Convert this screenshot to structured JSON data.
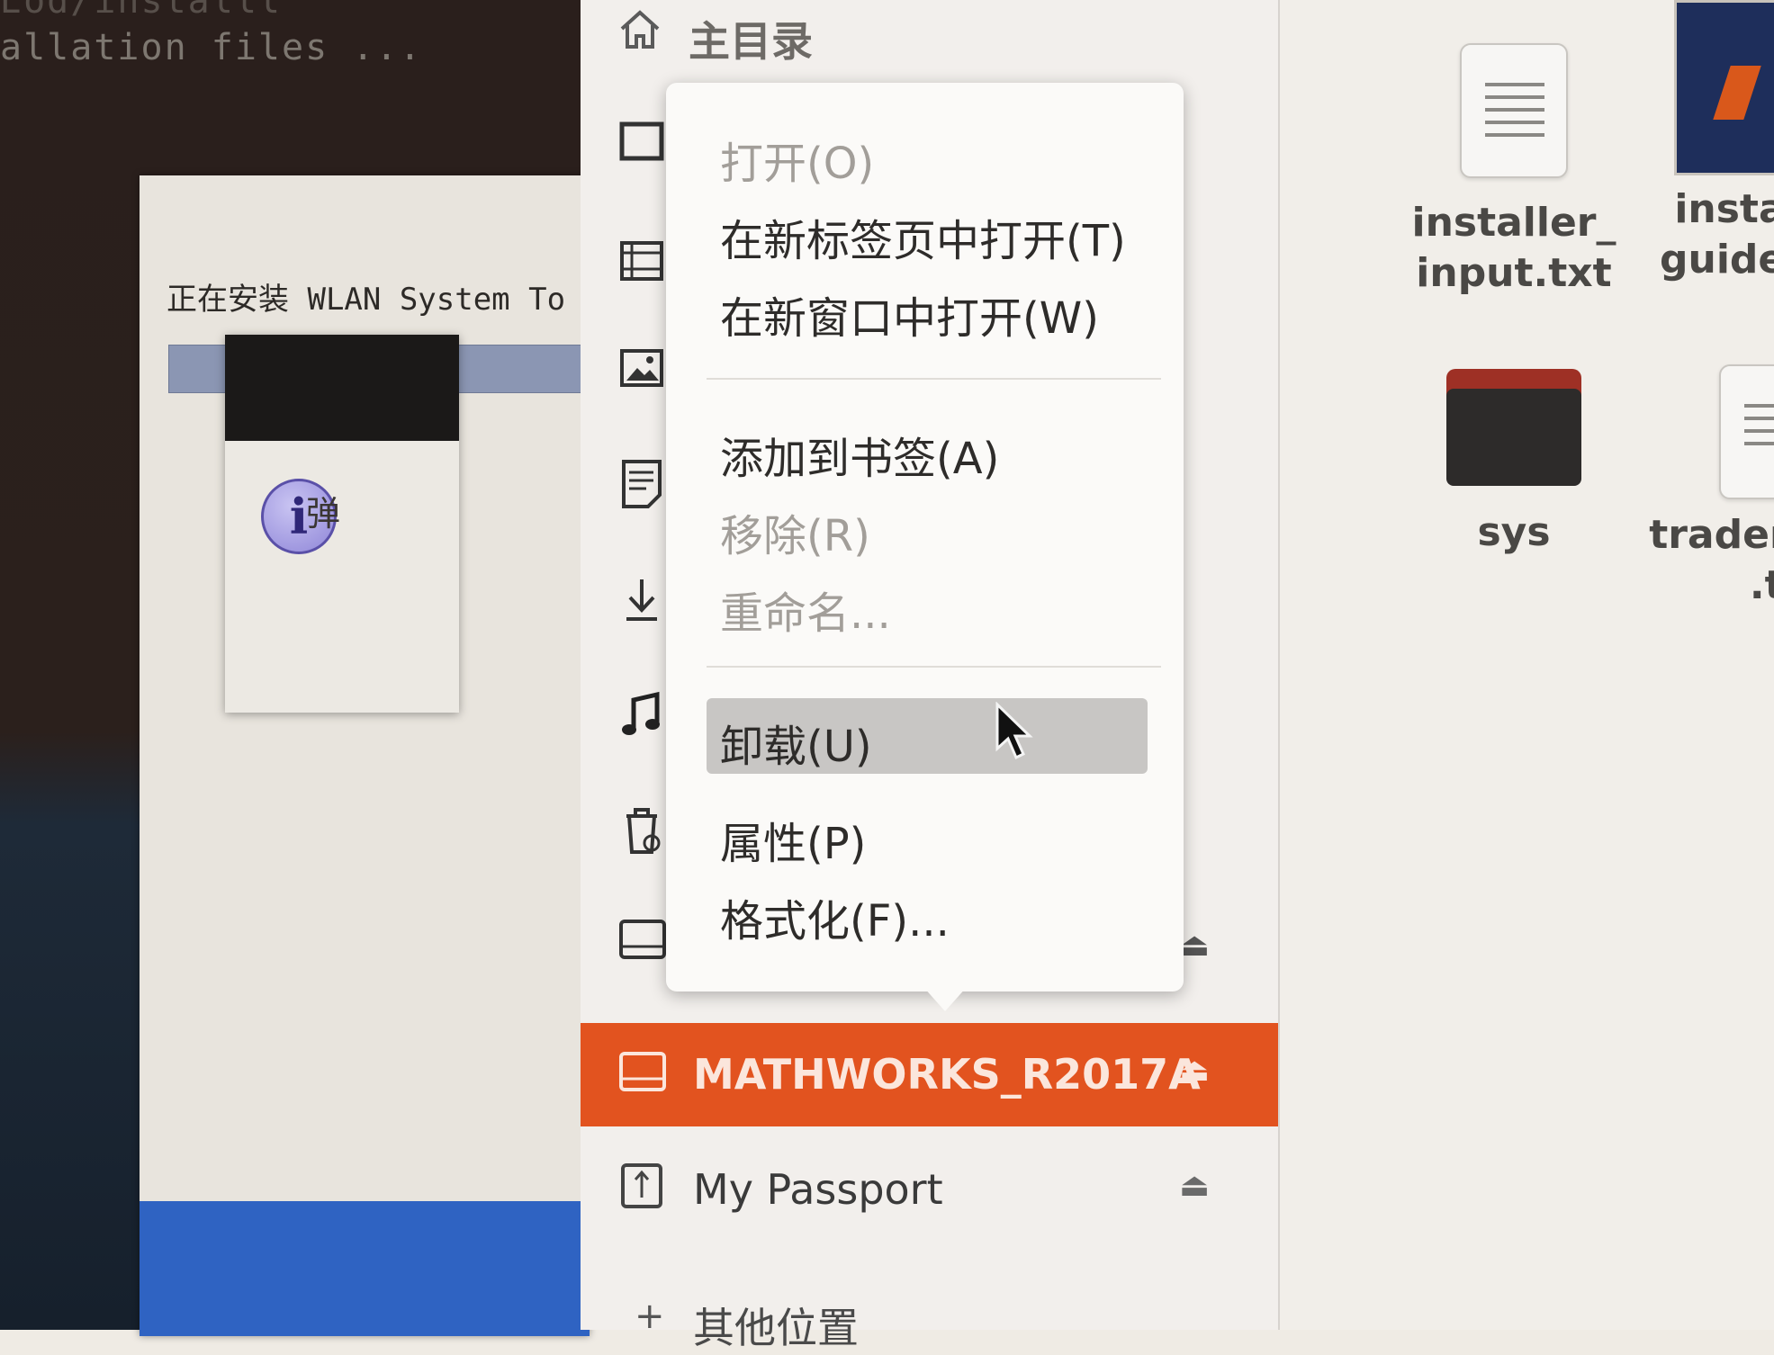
{
  "terminal": {
    "lines": [
      "Eod/installl",
      "allation files ..."
    ]
  },
  "installer": {
    "status_text": "正在安装 WLAN System To",
    "popup_text": "弹"
  },
  "sidebar": {
    "home_label": "主目录",
    "devices": [
      {
        "label": "MATHWORKS_R2017A",
        "icon": "drive-icon",
        "eject": "⏏",
        "selected": true
      },
      {
        "label": "My Passport",
        "icon": "usb-drive-icon",
        "eject": "⏏"
      },
      {
        "label": "其他位置",
        "icon": "plus-icon"
      }
    ],
    "selected_color": "#e2531f"
  },
  "context_menu": {
    "items": [
      {
        "label": "打开(O)",
        "enabled": false
      },
      {
        "label": "在新标签页中打开(T)",
        "enabled": true
      },
      {
        "label": "在新窗口中打开(W)",
        "enabled": true
      },
      {
        "label": "添加到书签(A)",
        "enabled": true
      },
      {
        "label": "移除(R)",
        "enabled": false
      },
      {
        "label": "重命名...",
        "enabled": false
      },
      {
        "label": "卸载(U)",
        "enabled": true,
        "hovered": true
      },
      {
        "label": "属性(P)",
        "enabled": true
      },
      {
        "label": "格式化(F)...",
        "enabled": true
      }
    ]
  },
  "files": [
    {
      "name_line1": "installer_",
      "name_line2": "input.txt",
      "icon": "text-file-icon"
    },
    {
      "name_line1": "insta",
      "name_line2": "guide.",
      "icon": "pdf-file-icon"
    },
    {
      "name_line1": "sys",
      "name_line2": "",
      "icon": "folder-icon"
    },
    {
      "name_line1": "tradem",
      "name_line2": ".tx",
      "icon": "text-file-icon"
    }
  ]
}
